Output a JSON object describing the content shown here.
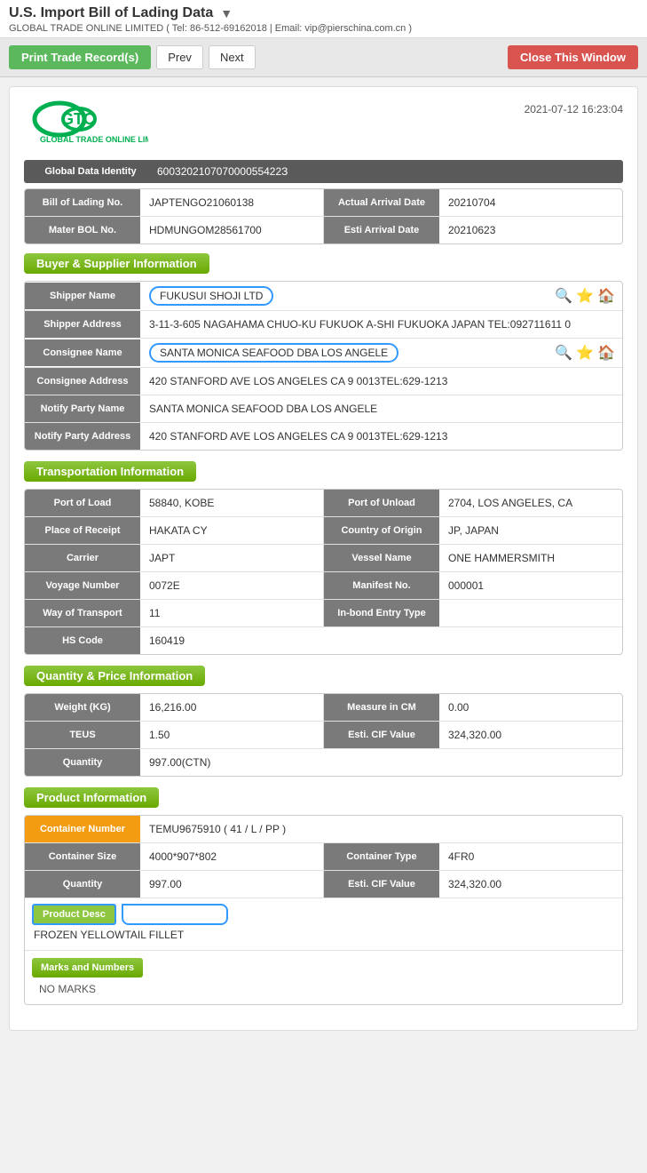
{
  "page": {
    "title": "U.S. Import Bill of Lading Data",
    "company": "GLOBAL TRADE ONLINE LIMITED ( Tel: 86-512-69162018 | Email: vip@pierschina.com.cn )",
    "timestamp": "2021-07-12 16:23:04"
  },
  "toolbar": {
    "print_label": "Print Trade Record(s)",
    "prev_label": "Prev",
    "next_label": "Next",
    "close_label": "Close This Window"
  },
  "global_data": {
    "label": "Global Data Identity",
    "value": "600320210707000055422З"
  },
  "bill": {
    "bol_label": "Bill of Lading No.",
    "bol_value": "JAPTENGO21060138",
    "arrival_label": "Actual Arrival Date",
    "arrival_value": "20210704",
    "master_label": "Mater BOL No.",
    "master_value": "HDMUNGOM28561700",
    "esti_label": "Esti Arrival Date",
    "esti_value": "20210623"
  },
  "buyer_section": {
    "header": "Buyer & Supplier Information",
    "shipper_name_label": "Shipper Name",
    "shipper_name_value": "FUKUSUI SHOJI LTD",
    "shipper_address_label": "Shipper Address",
    "shipper_address_value": "3-11-3-605 NAGAHAMA CHUO-KU FUKUOK A-SHI FUKUOKA JAPAN TEL:092711611 0",
    "consignee_name_label": "Consignee Name",
    "consignee_name_value": "SANTA MONICA SEAFOOD DBA LOS ANGELE",
    "consignee_address_label": "Consignee Address",
    "consignee_address_value": "420 STANFORD AVE LOS ANGELES CA 9 0013TEL:629-1213",
    "notify_name_label": "Notify Party Name",
    "notify_name_value": "SANTA MONICA SEAFOOD DBA LOS ANGELE",
    "notify_address_label": "Notify Party Address",
    "notify_address_value": "420 STANFORD AVE LOS ANGELES CA 9 0013TEL:629-1213"
  },
  "transport_section": {
    "header": "Transportation Information",
    "port_load_label": "Port of Load",
    "port_load_value": "58840, KOBE",
    "port_unload_label": "Port of Unload",
    "port_unload_value": "2704, LOS ANGELES, CA",
    "place_receipt_label": "Place of Receipt",
    "place_receipt_value": "HAKATA CY",
    "country_origin_label": "Country of Origin",
    "country_origin_value": "JP, JAPAN",
    "carrier_label": "Carrier",
    "carrier_value": "JAPT",
    "vessel_label": "Vessel Name",
    "vessel_value": "ONE HAMMERSMITH",
    "voyage_label": "Voyage Number",
    "voyage_value": "0072E",
    "manifest_label": "Manifest No.",
    "manifest_value": "000001",
    "way_transport_label": "Way of Transport",
    "way_transport_value": "11",
    "inbond_label": "In-bond Entry Type",
    "inbond_value": "",
    "hs_label": "HS Code",
    "hs_value": "160419"
  },
  "quantity_section": {
    "header": "Quantity & Price Information",
    "weight_label": "Weight (KG)",
    "weight_value": "16,216.00",
    "measure_label": "Measure in CM",
    "measure_value": "0.00",
    "teus_label": "TEUS",
    "teus_value": "1.50",
    "cif_label": "Esti. CIF Value",
    "cif_value": "324,320.00",
    "quantity_label": "Quantity",
    "quantity_value": "997.00(CTN)"
  },
  "product_section": {
    "header": "Product Information",
    "container_label": "Container Number",
    "container_value": "TEMU9675910 ( 41 / L / PP )",
    "container_size_label": "Container Size",
    "container_size_value": "4000*907*802",
    "container_type_label": "Container Type",
    "container_type_value": "4FR0",
    "quantity_label": "Quantity",
    "quantity_value": "997.00",
    "cif_label": "Esti. CIF Value",
    "cif_value": "324,320.00",
    "product_desc_label": "Product Desc",
    "product_desc_value": "FROZEN YELLOWTAIL FILLET",
    "marks_label": "Marks and Numbers",
    "marks_value": "NO MARKS"
  }
}
